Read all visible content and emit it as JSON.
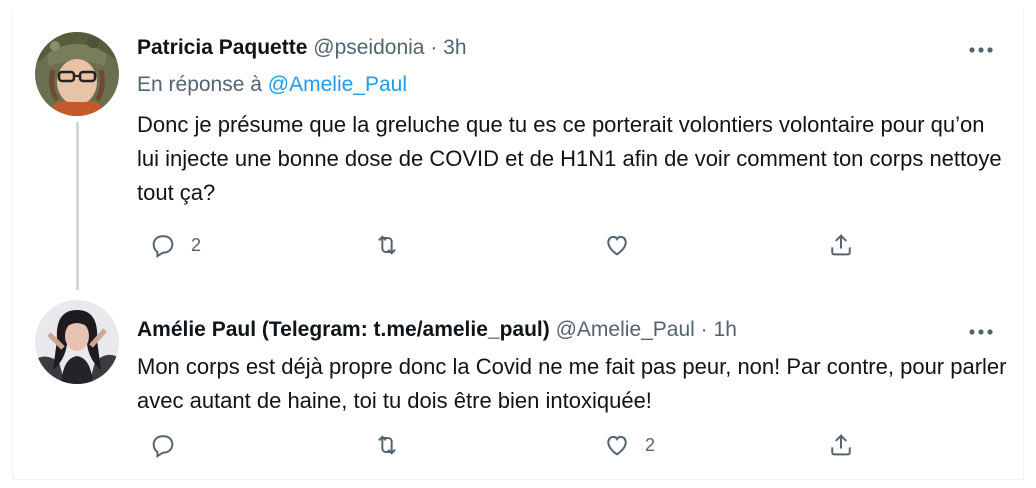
{
  "tweets": [
    {
      "author_name": "Patricia Paquette",
      "handle": "@pseidonia",
      "separator": "·",
      "time": "3h",
      "reply_prefix": "En réponse à",
      "reply_to": "@Amelie_Paul",
      "text": "Donc je présume que la greluche que tu es ce porterait volontiers volontaire pour qu’on lui injecte une bonne dose de COVID et de H1N1 afin de voir comment ton corps nettoye tout ça?",
      "reply_count": "2",
      "retweet_count": "",
      "like_count": "",
      "icons": [
        "reply-icon",
        "retweet-icon",
        "like-icon",
        "share-icon",
        "more-icon"
      ]
    },
    {
      "author_name": "Amélie Paul (Telegram: t.me/amelie_paul)",
      "handle": "@Amelie_Paul",
      "separator": "·",
      "time": "1h",
      "text": "Mon corps est déjà propre donc la Covid ne me fait pas peur, non! Par contre, pour parler avec autant de haine, toi tu dois être bien intoxiquée!",
      "reply_count": "",
      "retweet_count": "",
      "like_count": "2",
      "icons": [
        "reply-icon",
        "retweet-icon",
        "like-icon",
        "share-icon",
        "more-icon"
      ]
    }
  ],
  "colors": {
    "text": "#0f1419",
    "secondary": "#536471",
    "link": "#1d9bf0",
    "thread_line": "#cfd9de"
  }
}
